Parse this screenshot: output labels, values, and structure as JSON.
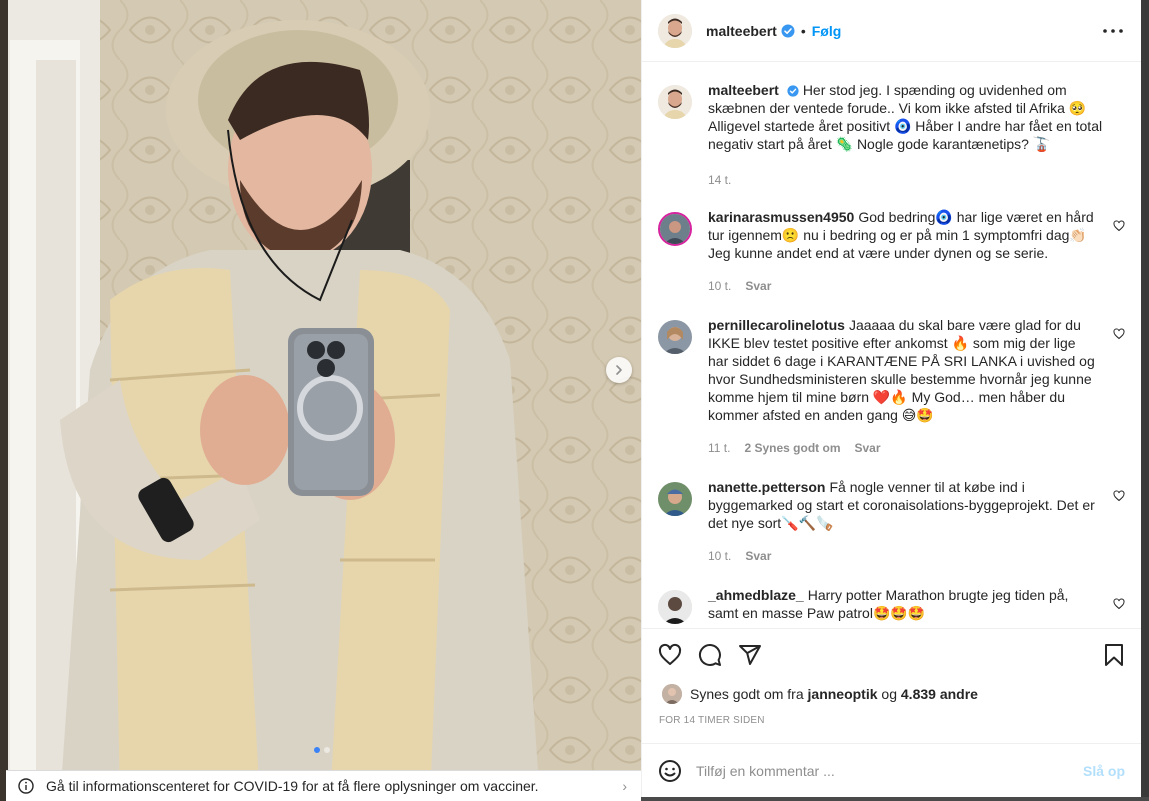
{
  "post": {
    "author": "malteebert",
    "follow_label": "Følg",
    "dot_separator": "•",
    "caption": "Her stod jeg. I spænding og uvidenhed om skæbnen der ventede forude.. Vi kom ikke afsted til Afrika 🥺 Alligevel startede året positivt 🧿 Håber I andre har fået en total negativ start på året 🦠 Nogle gode karantænetips? 🚡",
    "caption_time": "14 t."
  },
  "comments": [
    {
      "username": "karinarasmussen4950",
      "text": "God bedring🧿 har lige været en hård tur igennem🙁 nu i bedring og er på min 1 symptomfri dag👏🏻 Jeg kunne andet end at være under dynen og se serie.",
      "time": "10 t.",
      "likes": "",
      "reply": "Svar"
    },
    {
      "username": "pernillecarolinelotus",
      "text": "Jaaaaa du skal bare være glad for du IKKE blev testet positive efter ankomst 🔥 som mig der lige har siddet 6 dage i KARANTÆNE PÅ SRI LANKA i uvished og hvor Sundhedsministeren skulle bestemme hvornår jeg kunne komme hjem til mine børn ❤️🔥 My God… men håber du kommer afsted en anden gang 😅🤩",
      "time": "11 t.",
      "likes": "2 Synes godt om",
      "reply": "Svar"
    },
    {
      "username": "nanette.petterson",
      "text": "Få nogle venner til at købe ind i byggemarked og start et coronaisolations-byggeprojekt. Det er det nye sort🪛🔨🪚",
      "time": "10 t.",
      "likes": "",
      "reply": "Svar"
    },
    {
      "username": "_ahmedblaze_",
      "text": "Harry potter Marathon brugte jeg tiden på, samt en masse Paw patrol🤩🤩🤩",
      "time": "",
      "likes": "",
      "reply": ""
    }
  ],
  "likes_line": {
    "prefix": "Synes godt om fra",
    "user": "janneoptik",
    "joiner": "og",
    "others": "4.839 andre"
  },
  "time_ago": "FOR 14 TIMER SIDEN",
  "comment_input": {
    "placeholder": "Tilføj en kommentar ...",
    "post_label": "Slå op"
  },
  "covid_banner": "Gå til informationscenteret for COVID-19 for at få flere oplysninger om vacciner.",
  "colors": {
    "accent": "#0095f6",
    "verified": "#3897f0",
    "post_disabled": "#b2dffc",
    "muted": "#8e8e8e"
  },
  "icons": [
    "verified-badge-icon",
    "more-options-icon",
    "heart-icon",
    "comment-icon",
    "share-icon",
    "bookmark-icon",
    "emoji-icon",
    "chevron-right-icon",
    "info-icon"
  ]
}
